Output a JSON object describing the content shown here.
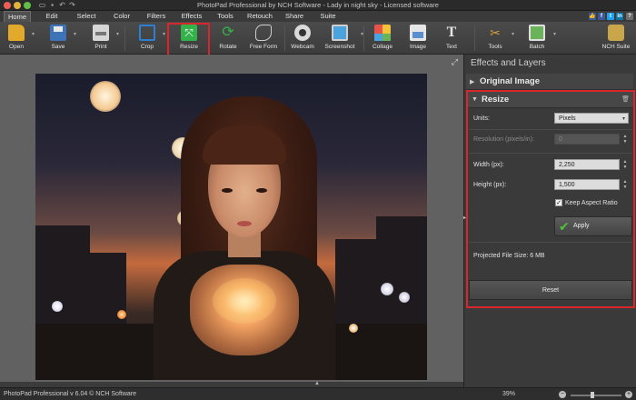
{
  "window": {
    "title": "PhotoPad Professional by NCH Software - Lady in night sky - Licensed software"
  },
  "menu": {
    "tabs": [
      {
        "label": "Home",
        "active": true
      },
      {
        "label": "Edit"
      },
      {
        "label": "Select"
      },
      {
        "label": "Color"
      },
      {
        "label": "Filters"
      },
      {
        "label": "Effects"
      },
      {
        "label": "Tools"
      },
      {
        "label": "Retouch"
      },
      {
        "label": "Share"
      },
      {
        "label": "Suite"
      }
    ]
  },
  "toolbar": {
    "items": [
      {
        "label": "Open",
        "icon": "open-folder-icon",
        "color": "#e3a92b"
      },
      {
        "label": "Save",
        "icon": "save-disk-icon",
        "color": "#3f73b8"
      },
      {
        "label": "Print",
        "icon": "printer-icon",
        "color": "#d6d6d6"
      },
      {
        "label": "Crop",
        "icon": "crop-icon",
        "color": "#2d7fd6"
      },
      {
        "label": "Resize",
        "icon": "resize-arrows-icon",
        "color": "#34b24a"
      },
      {
        "label": "Rotate",
        "icon": "rotate-icon",
        "color": "#35b34b"
      },
      {
        "label": "Free Form",
        "icon": "free-form-icon",
        "color": "#cfcfcf"
      },
      {
        "label": "Webcam",
        "icon": "webcam-icon",
        "color": "#d9d9d9"
      },
      {
        "label": "Screenshot",
        "icon": "screenshot-icon",
        "color": "#4aa3df"
      },
      {
        "label": "Collage",
        "icon": "collage-icon",
        "color": "#e8534a"
      },
      {
        "label": "Image",
        "icon": "image-icon",
        "color": "#e6e6e6"
      },
      {
        "label": "Text",
        "icon": "text-icon",
        "color": "#e6e6e6"
      },
      {
        "label": "Tools",
        "icon": "tools-icon",
        "color": "#d6a13a"
      },
      {
        "label": "Batch",
        "icon": "batch-icon",
        "color": "#6bb35a"
      },
      {
        "label": "NCH Suite",
        "icon": "nch-suite-icon",
        "color": "#c9a64a"
      }
    ]
  },
  "panel": {
    "title": "Effects and Layers",
    "original_image_label": "Original Image",
    "resize": {
      "title": "Resize",
      "units_label": "Units:",
      "units_value": "Pixels",
      "resolution_label": "Resolution (pixels/in):",
      "resolution_value": "0",
      "width_label": "Width (px):",
      "width_value": "2,250",
      "height_label": "Height (px):",
      "height_value": "1,500",
      "keep_aspect_label": "Keep Aspect Ratio",
      "keep_aspect_checked": true,
      "apply_label": "Apply",
      "projected_label": "Projected File Size: 6 MB",
      "reset_label": "Reset"
    }
  },
  "status": {
    "left_text": "PhotoPad Professional v 6.04 © NCH Software",
    "zoom_text": "39%"
  },
  "colors": {
    "highlight": "#d8262a",
    "apply_check": "#4ec33a"
  }
}
